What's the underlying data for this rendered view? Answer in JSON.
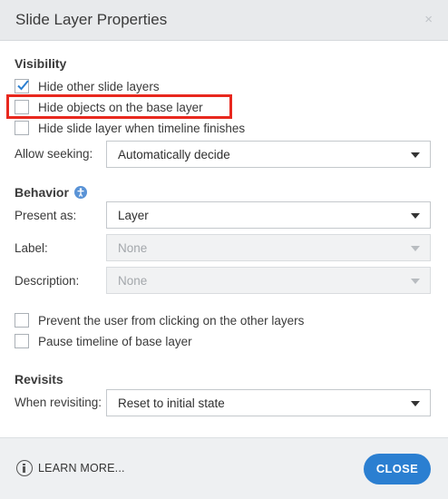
{
  "dialog": {
    "title": "Slide Layer Properties",
    "close_glyph": "×"
  },
  "visibility": {
    "heading": "Visibility",
    "options": [
      {
        "label": "Hide other slide layers",
        "checked": true
      },
      {
        "label": "Hide objects on the base layer",
        "checked": false
      },
      {
        "label": "Hide slide layer when timeline finishes",
        "checked": false
      }
    ],
    "allow_seeking": {
      "label": "Allow seeking:",
      "value": "Automatically decide"
    }
  },
  "behavior": {
    "heading": "Behavior",
    "present_as": {
      "label": "Present as:",
      "value": "Layer"
    },
    "label_field": {
      "label": "Label:",
      "value": "None"
    },
    "description_field": {
      "label": "Description:",
      "value": "None"
    },
    "options": [
      {
        "label": "Prevent the user from clicking on the other layers",
        "checked": false
      },
      {
        "label": "Pause timeline of base layer",
        "checked": false
      }
    ]
  },
  "revisits": {
    "heading": "Revisits",
    "when_revisiting": {
      "label": "When revisiting:",
      "value": "Reset to initial state"
    }
  },
  "footer": {
    "learn_more": "LEARN MORE...",
    "close": "CLOSE"
  },
  "colors": {
    "accent": "#2b7fd1",
    "highlight": "#e8281e",
    "info_badge": "#5a93d6"
  }
}
